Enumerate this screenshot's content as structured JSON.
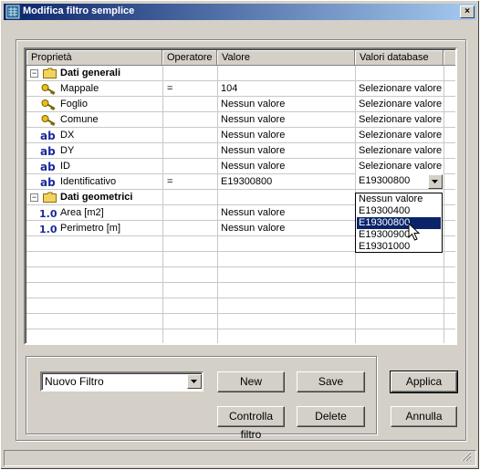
{
  "window": {
    "title": "Modifica filtro semplice",
    "close_label": "×"
  },
  "grid": {
    "columns": [
      "Proprietà",
      "Operatore",
      "Valore",
      "Valori database"
    ],
    "rows": [
      {
        "type": "group",
        "expander": "−",
        "icon": "folder-icon",
        "name": "Dati generali",
        "operator": "",
        "value": "",
        "db": ""
      },
      {
        "type": "field",
        "icon": "key-icon",
        "name": "Mappale",
        "operator": "=",
        "value": "104",
        "db": "Selezionare valore"
      },
      {
        "type": "field",
        "icon": "key-icon",
        "name": "Foglio",
        "operator": "",
        "value": "Nessun valore",
        "db": "Selezionare valore"
      },
      {
        "type": "field",
        "icon": "key-icon",
        "name": "Comune",
        "operator": "",
        "value": "Nessun valore",
        "db": "Selezionare valore"
      },
      {
        "type": "field",
        "icon": "text-type-icon",
        "icon_text": "ab",
        "name": "DX",
        "operator": "",
        "value": "Nessun valore",
        "db": "Selezionare valore"
      },
      {
        "type": "field",
        "icon": "text-type-icon",
        "icon_text": "ab",
        "name": "DY",
        "operator": "",
        "value": "Nessun valore",
        "db": "Selezionare valore"
      },
      {
        "type": "field",
        "icon": "text-type-icon",
        "icon_text": "ab",
        "name": "ID",
        "operator": "",
        "value": "Nessun valore",
        "db": "Selezionare valore"
      },
      {
        "type": "field",
        "icon": "text-type-icon",
        "icon_text": "ab",
        "name": "Identificativo",
        "operator": "=",
        "value": "E19300800",
        "db": "E19300800"
      },
      {
        "type": "group",
        "expander": "−",
        "icon": "folder-icon",
        "name": "Dati geometrici",
        "operator": "",
        "value": "",
        "db": ""
      },
      {
        "type": "field",
        "icon": "numeric-type-icon",
        "icon_text": "1.0",
        "name": "Area [m2]",
        "operator": "",
        "value": "Nessun valore",
        "db": ""
      },
      {
        "type": "field",
        "icon": "numeric-type-icon",
        "icon_text": "1.0",
        "name": "Perimetro [m]",
        "operator": "",
        "value": "Nessun valore",
        "db": ""
      }
    ]
  },
  "dropdown": {
    "options": [
      "Nessun valore",
      "E19300400",
      "E19300800",
      "E19300900",
      "E19301000"
    ],
    "selected_index": 2
  },
  "filter_select": {
    "value": "Nuovo Filtro"
  },
  "buttons": {
    "new": "New",
    "save": "Save",
    "check": "Controlla filtro",
    "delete": "Delete",
    "apply": "Applica",
    "cancel": "Annulla"
  },
  "colors": {
    "titlebar_start": "#0a246a",
    "titlebar_end": "#a6caf0",
    "selection": "#0a246a",
    "type_icon": "#1a2a9a",
    "folder": "#f2d35e"
  }
}
